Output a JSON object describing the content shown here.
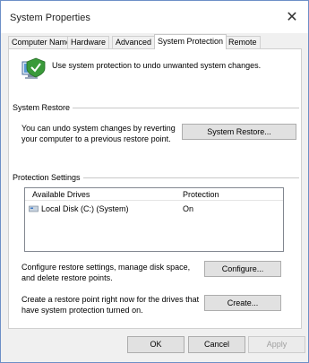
{
  "window": {
    "title": "System Properties",
    "close_glyph": "✕"
  },
  "tabs": [
    {
      "label": "Computer Name"
    },
    {
      "label": "Hardware"
    },
    {
      "label": "Advanced"
    },
    {
      "label": "System Protection",
      "active": true
    },
    {
      "label": "Remote"
    }
  ],
  "intro": {
    "text": "Use system protection to undo unwanted system changes.",
    "icon": "system-protection-icon"
  },
  "system_restore": {
    "group_title": "System Restore",
    "description_line1": "You can undo system changes by reverting",
    "description_line2": "your computer to a previous restore point.",
    "button_label": "System Restore..."
  },
  "protection_settings": {
    "group_title": "Protection Settings",
    "columns": [
      "Available Drives",
      "Protection"
    ],
    "rows": [
      {
        "drive": "Local Disk (C:) (System)",
        "protection": "On",
        "icon": "drive-icon"
      }
    ],
    "configure_text_line1": "Configure restore settings, manage disk space,",
    "configure_text_line2": "and delete restore points.",
    "configure_button": "Configure...",
    "create_text_line1": "Create a restore point right now for the drives that",
    "create_text_line2": "have system protection turned on.",
    "create_button": "Create..."
  },
  "footer": {
    "ok": "OK",
    "cancel": "Cancel",
    "apply": "Apply"
  }
}
